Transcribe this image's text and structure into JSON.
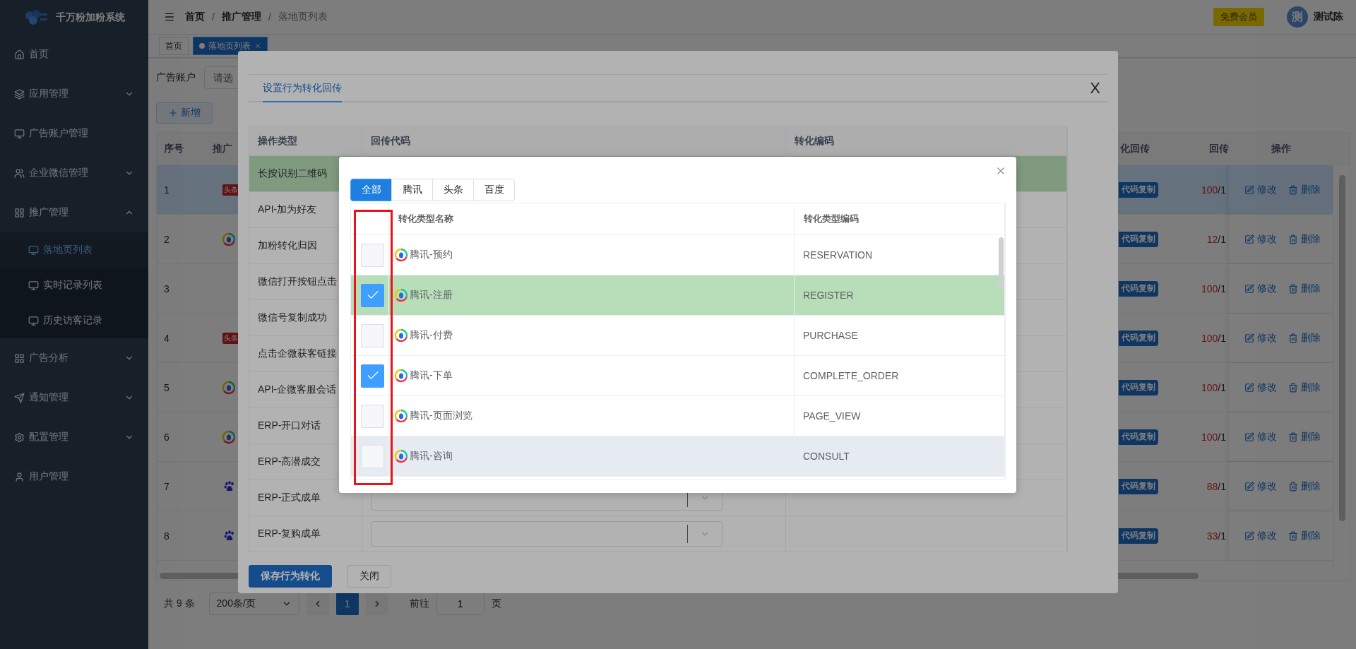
{
  "sidebar": {
    "title": "千万粉加粉系统",
    "items": [
      {
        "label": "首页"
      },
      {
        "label": "应用管理",
        "expanded": false
      },
      {
        "label": "广告账户管理"
      },
      {
        "label": "企业微信管理",
        "expanded": false
      },
      {
        "label": "推广管理",
        "expanded": true,
        "children": [
          {
            "label": "落地页列表",
            "selected": true
          },
          {
            "label": "实时记录列表",
            "selected": false
          },
          {
            "label": "历史访客记录",
            "selected": false
          }
        ]
      },
      {
        "label": "广告分析",
        "expanded": false
      },
      {
        "label": "通知管理",
        "expanded": false
      },
      {
        "label": "配置管理",
        "expanded": false
      },
      {
        "label": "用户管理"
      }
    ]
  },
  "header": {
    "separator": "/",
    "breadcrumb": [
      {
        "label": "首页",
        "current": false
      },
      {
        "label": "推广管理",
        "current": false
      },
      {
        "label": "落地页列表",
        "current": true
      }
    ],
    "badge": "免费会员",
    "avatar": "测",
    "user": "测试陈"
  },
  "tags": [
    {
      "label": "首页",
      "selected": false
    },
    {
      "label": "落地页列表",
      "selected": true
    }
  ],
  "filter": {
    "label": "广告账户",
    "placeholder": "请选"
  },
  "new_button": "新增",
  "table": {
    "columns": [
      "序号",
      "推广",
      "化回传",
      "回传",
      "操作"
    ],
    "rows": [
      {
        "index": "1",
        "kind": "toutiao",
        "badge": "头条",
        "copy": "代码复制",
        "ratio": "100",
        "ratio_rest": "/1",
        "edit": "修改",
        "delete": "删除",
        "selected": true
      },
      {
        "index": "2",
        "kind": "tencent",
        "copy": "代码复制",
        "ratio": "12",
        "ratio_rest": "/1",
        "edit": "修改",
        "delete": "删除",
        "selected": false
      },
      {
        "index": "3",
        "kind": "none",
        "copy": "代码复制",
        "ratio": "100",
        "ratio_rest": "/1",
        "edit": "修改",
        "delete": "删除",
        "selected": false
      },
      {
        "index": "4",
        "kind": "toutiao",
        "badge": "头条",
        "copy": "代码复制",
        "ratio": "100",
        "ratio_rest": "/1",
        "edit": "修改",
        "delete": "删除",
        "selected": false
      },
      {
        "index": "5",
        "kind": "tencent",
        "copy": "代码复制",
        "ratio": "100",
        "ratio_rest": "/1",
        "edit": "修改",
        "delete": "删除",
        "selected": false
      },
      {
        "index": "6",
        "kind": "tencent",
        "copy": "代码复制",
        "ratio": "100",
        "ratio_rest": "/1",
        "edit": "修改",
        "delete": "删除",
        "selected": false
      },
      {
        "index": "7",
        "kind": "baidu",
        "copy": "代码复制",
        "ratio": "88",
        "ratio_rest": "/1",
        "edit": "修改",
        "delete": "删除",
        "selected": false
      },
      {
        "index": "8",
        "kind": "baidu",
        "copy": "代码复制",
        "ratio": "33",
        "ratio_rest": "/1",
        "edit": "修改",
        "delete": "删除",
        "selected": false
      }
    ]
  },
  "pagination": {
    "total": "共 9 条",
    "size": "200条/页",
    "pages": [
      {
        "label": "1",
        "selected": true
      }
    ],
    "goto": "前往",
    "page_input": "1",
    "page_suffix": "页"
  },
  "outer_dialog": {
    "tab": "设置行为转化回传",
    "close": "X",
    "columns": [
      "操作类型",
      "回传代码",
      "转化编码"
    ],
    "rows": [
      {
        "type": "长按识别二维码",
        "kind": "plain",
        "selected": true
      },
      {
        "type": "API-加为好友",
        "kind": "plain",
        "selected": false
      },
      {
        "type": "加粉转化归因",
        "kind": "plain",
        "selected": false
      },
      {
        "type": "微信打开按钮点击",
        "kind": "plain",
        "selected": false
      },
      {
        "type": "微信号复制成功",
        "kind": "plain",
        "selected": false
      },
      {
        "type": "点击企微获客链接",
        "kind": "plain",
        "selected": false
      },
      {
        "type": "API-企微客服会话",
        "kind": "plain",
        "selected": false
      },
      {
        "type": "ERP-开口对话",
        "kind": "plain",
        "selected": false
      },
      {
        "type": "ERP-高潜成交",
        "kind": "plain",
        "selected": false
      },
      {
        "type": "ERP-正式成单",
        "kind": "select",
        "selected": false
      },
      {
        "type": "ERP-复购成单",
        "kind": "select",
        "selected": false
      }
    ],
    "buttons": [
      {
        "label": "保存行为转化",
        "kind": "primary"
      },
      {
        "label": "关闭",
        "kind": "default"
      }
    ]
  },
  "inner_dialog": {
    "tabs": [
      {
        "label": "全部",
        "selected": true
      },
      {
        "label": "腾讯",
        "selected": false
      },
      {
        "label": "头条",
        "selected": false
      },
      {
        "label": "百度",
        "selected": false
      }
    ],
    "columns": [
      "转化类型名称",
      "转化类型编码"
    ],
    "checkbox_column_highlighted": true,
    "rows": [
      {
        "name": "腾讯-预约",
        "code": "RESERVATION",
        "checked": false,
        "selected": false,
        "hovered": false
      },
      {
        "name": "腾讯-注册",
        "code": "REGISTER",
        "checked": true,
        "selected": true,
        "hovered": false
      },
      {
        "name": "腾讯-付费",
        "code": "PURCHASE",
        "checked": false,
        "selected": false,
        "hovered": false
      },
      {
        "name": "腾讯-下单",
        "code": "COMPLETE_ORDER",
        "checked": true,
        "selected": false,
        "hovered": false
      },
      {
        "name": "腾讯-页面浏览",
        "code": "PAGE_VIEW",
        "checked": false,
        "selected": false,
        "hovered": false
      },
      {
        "name": "腾讯-咨询",
        "code": "CONSULT",
        "checked": false,
        "selected": false,
        "hovered": true
      }
    ]
  }
}
